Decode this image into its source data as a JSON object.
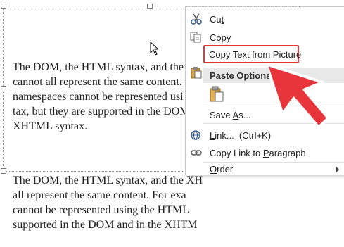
{
  "document": {
    "paragraph1": [
      "The DOM, the HTML syntax, and the",
      "cannot all represent the same content.",
      "namespaces cannot be represented usi",
      "tax, but they are supported in the DOM",
      "XHTML syntax."
    ],
    "paragraph2": [
      "The DOM, the HTML syntax, and the XH",
      "all represent the same content. For exa",
      "cannot be represented using the HTML",
      "supported in the DOM and in the XHTM"
    ]
  },
  "context_menu": {
    "cut": {
      "prefix": "Cu",
      "accel": "t",
      "suffix": ""
    },
    "copy": {
      "prefix": "",
      "accel": "C",
      "suffix": "opy"
    },
    "copy_text_from_picture": "Copy Text from Picture",
    "paste_options_header": "Paste Options:",
    "save_as": {
      "prefix": "Save ",
      "accel": "A",
      "suffix": "s..."
    },
    "link": {
      "prefix": "",
      "accel": "L",
      "suffix": "ink...  (Ctrl+K)"
    },
    "copy_link_to_paragraph": {
      "prefix": "Copy Link to ",
      "accel": "P",
      "suffix": "aragraph"
    },
    "order": {
      "prefix": "",
      "accel": "O",
      "suffix": "rder"
    }
  },
  "colors": {
    "highlight_border": "#e8353b",
    "arrow_fill": "#e8353b",
    "section_header_bg": "#e8e8e8"
  }
}
